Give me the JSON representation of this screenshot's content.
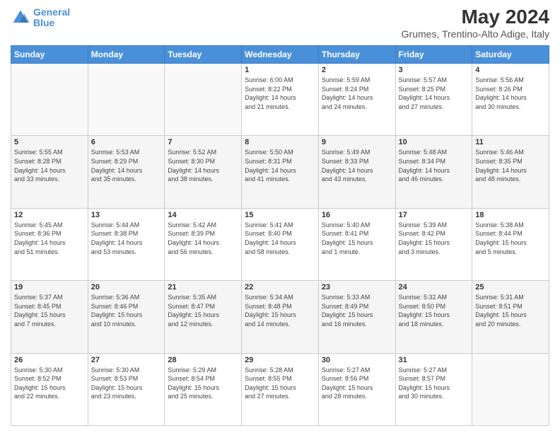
{
  "header": {
    "logo_line1": "General",
    "logo_line2": "Blue",
    "month": "May 2024",
    "location": "Grumes, Trentino-Alto Adige, Italy"
  },
  "days_of_week": [
    "Sunday",
    "Monday",
    "Tuesday",
    "Wednesday",
    "Thursday",
    "Friday",
    "Saturday"
  ],
  "weeks": [
    [
      {
        "day": "",
        "info": ""
      },
      {
        "day": "",
        "info": ""
      },
      {
        "day": "",
        "info": ""
      },
      {
        "day": "1",
        "info": "Sunrise: 6:00 AM\nSunset: 8:22 PM\nDaylight: 14 hours\nand 21 minutes."
      },
      {
        "day": "2",
        "info": "Sunrise: 5:59 AM\nSunset: 8:24 PM\nDaylight: 14 hours\nand 24 minutes."
      },
      {
        "day": "3",
        "info": "Sunrise: 5:57 AM\nSunset: 8:25 PM\nDaylight: 14 hours\nand 27 minutes."
      },
      {
        "day": "4",
        "info": "Sunrise: 5:56 AM\nSunset: 8:26 PM\nDaylight: 14 hours\nand 30 minutes."
      }
    ],
    [
      {
        "day": "5",
        "info": "Sunrise: 5:55 AM\nSunset: 8:28 PM\nDaylight: 14 hours\nand 33 minutes."
      },
      {
        "day": "6",
        "info": "Sunrise: 5:53 AM\nSunset: 8:29 PM\nDaylight: 14 hours\nand 35 minutes."
      },
      {
        "day": "7",
        "info": "Sunrise: 5:52 AM\nSunset: 8:30 PM\nDaylight: 14 hours\nand 38 minutes."
      },
      {
        "day": "8",
        "info": "Sunrise: 5:50 AM\nSunset: 8:31 PM\nDaylight: 14 hours\nand 41 minutes."
      },
      {
        "day": "9",
        "info": "Sunrise: 5:49 AM\nSunset: 8:33 PM\nDaylight: 14 hours\nand 43 minutes."
      },
      {
        "day": "10",
        "info": "Sunrise: 5:48 AM\nSunset: 8:34 PM\nDaylight: 14 hours\nand 46 minutes."
      },
      {
        "day": "11",
        "info": "Sunrise: 5:46 AM\nSunset: 8:35 PM\nDaylight: 14 hours\nand 48 minutes."
      }
    ],
    [
      {
        "day": "12",
        "info": "Sunrise: 5:45 AM\nSunset: 8:36 PM\nDaylight: 14 hours\nand 51 minutes."
      },
      {
        "day": "13",
        "info": "Sunrise: 5:44 AM\nSunset: 8:38 PM\nDaylight: 14 hours\nand 53 minutes."
      },
      {
        "day": "14",
        "info": "Sunrise: 5:42 AM\nSunset: 8:39 PM\nDaylight: 14 hours\nand 56 minutes."
      },
      {
        "day": "15",
        "info": "Sunrise: 5:41 AM\nSunset: 8:40 PM\nDaylight: 14 hours\nand 58 minutes."
      },
      {
        "day": "16",
        "info": "Sunrise: 5:40 AM\nSunset: 8:41 PM\nDaylight: 15 hours\nand 1 minute."
      },
      {
        "day": "17",
        "info": "Sunrise: 5:39 AM\nSunset: 8:42 PM\nDaylight: 15 hours\nand 3 minutes."
      },
      {
        "day": "18",
        "info": "Sunrise: 5:38 AM\nSunset: 8:44 PM\nDaylight: 15 hours\nand 5 minutes."
      }
    ],
    [
      {
        "day": "19",
        "info": "Sunrise: 5:37 AM\nSunset: 8:45 PM\nDaylight: 15 hours\nand 7 minutes."
      },
      {
        "day": "20",
        "info": "Sunrise: 5:36 AM\nSunset: 8:46 PM\nDaylight: 15 hours\nand 10 minutes."
      },
      {
        "day": "21",
        "info": "Sunrise: 5:35 AM\nSunset: 8:47 PM\nDaylight: 15 hours\nand 12 minutes."
      },
      {
        "day": "22",
        "info": "Sunrise: 5:34 AM\nSunset: 8:48 PM\nDaylight: 15 hours\nand 14 minutes."
      },
      {
        "day": "23",
        "info": "Sunrise: 5:33 AM\nSunset: 8:49 PM\nDaylight: 15 hours\nand 16 minutes."
      },
      {
        "day": "24",
        "info": "Sunrise: 5:32 AM\nSunset: 8:50 PM\nDaylight: 15 hours\nand 18 minutes."
      },
      {
        "day": "25",
        "info": "Sunrise: 5:31 AM\nSunset: 8:51 PM\nDaylight: 15 hours\nand 20 minutes."
      }
    ],
    [
      {
        "day": "26",
        "info": "Sunrise: 5:30 AM\nSunset: 8:52 PM\nDaylight: 15 hours\nand 22 minutes."
      },
      {
        "day": "27",
        "info": "Sunrise: 5:30 AM\nSunset: 8:53 PM\nDaylight: 15 hours\nand 23 minutes."
      },
      {
        "day": "28",
        "info": "Sunrise: 5:29 AM\nSunset: 8:54 PM\nDaylight: 15 hours\nand 25 minutes."
      },
      {
        "day": "29",
        "info": "Sunrise: 5:28 AM\nSunset: 8:55 PM\nDaylight: 15 hours\nand 27 minutes."
      },
      {
        "day": "30",
        "info": "Sunrise: 5:27 AM\nSunset: 8:56 PM\nDaylight: 15 hours\nand 28 minutes."
      },
      {
        "day": "31",
        "info": "Sunrise: 5:27 AM\nSunset: 8:57 PM\nDaylight: 15 hours\nand 30 minutes."
      },
      {
        "day": "",
        "info": ""
      }
    ]
  ]
}
